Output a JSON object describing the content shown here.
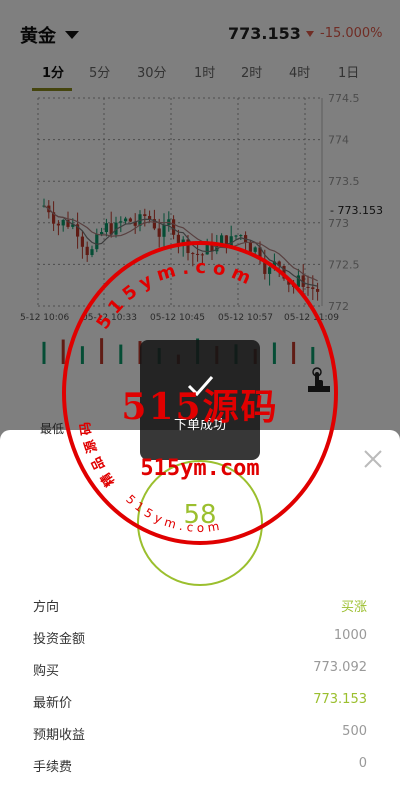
{
  "header": {
    "asset": "黄金",
    "price": "773.153",
    "change": "-15.000%"
  },
  "tabs": [
    "1分",
    "5分",
    "30分",
    "1时",
    "2时",
    "4时",
    "1日"
  ],
  "chart_data": {
    "type": "candlestick",
    "y_ticks": [
      "774.5",
      "774",
      "773.5",
      "773",
      "772.5",
      "772"
    ],
    "x_ticks": [
      "5-12 10:06",
      "05-12 10:33",
      "05-12 10:45",
      "05-12 10:57",
      "05-12 11:09"
    ],
    "ylim": [
      772,
      774.5
    ],
    "last_price_label": "- 773.153"
  },
  "toast": {
    "text": "下单成功"
  },
  "partial_label": "最低",
  "countdown": "58",
  "order": [
    {
      "label": "方向",
      "value": "买涨",
      "green": true
    },
    {
      "label": "投资金额",
      "value": "1000",
      "green": false
    },
    {
      "label": "购买",
      "value": "773.092",
      "green": false
    },
    {
      "label": "最新价",
      "value": "773.153",
      "green": true
    },
    {
      "label": "预期收益",
      "value": "500",
      "green": false
    },
    {
      "label": "手续费",
      "value": "0",
      "green": false
    }
  ],
  "watermark": {
    "main": "515源码",
    "sub": "515ym.com",
    "ring_top": "515ym.com",
    "ring_left": "精品源码",
    "ring_bottom": "515ym.com"
  },
  "colors": {
    "up": "#0a9a6a",
    "down": "#c0392b",
    "accent": "#9bbf2e",
    "stamp": "#e00000"
  }
}
